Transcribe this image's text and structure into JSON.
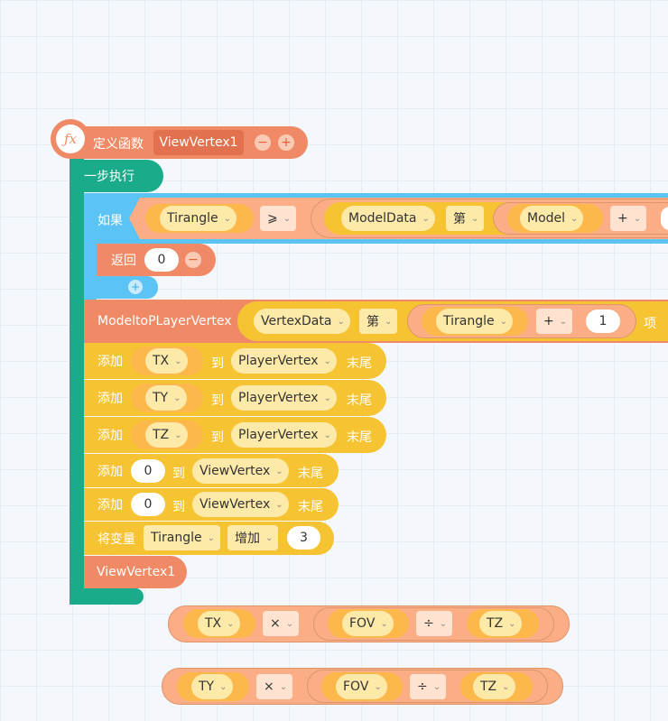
{
  "func": {
    "icon": "ƒx",
    "define_label": "定义函数",
    "name": "ViewVertex1",
    "minus": "−",
    "plus": "+"
  },
  "step_block": {
    "label": "一步执行"
  },
  "if_block": {
    "label": "如果",
    "var1": "Tirangle",
    "op": "⩾",
    "list": "ModelData",
    "nth": "第",
    "var2": "Model",
    "plus_op": "+",
    "add_button": "+"
  },
  "return_block": {
    "label": "返回",
    "value": "0",
    "minus": "−"
  },
  "call_block": {
    "name": "ModeltoPLayerVertex",
    "list": "VertexData",
    "nth": "第",
    "var": "Tirangle",
    "op": "+",
    "num": "1",
    "item": "项"
  },
  "add_rows": [
    {
      "add": "添加",
      "var": "TX",
      "to": "到",
      "list": "PlayerVertex",
      "end": "末尾"
    },
    {
      "add": "添加",
      "var": "TY",
      "to": "到",
      "list": "PlayerVertex",
      "end": "末尾"
    },
    {
      "add": "添加",
      "var": "TZ",
      "to": "到",
      "list": "PlayerVertex",
      "end": "末尾"
    },
    {
      "add": "添加",
      "var": "0",
      "to": "到",
      "list": "ViewVertex",
      "end": "末尾"
    },
    {
      "add": "添加",
      "var": "0",
      "to": "到",
      "list": "ViewVertex",
      "end": "末尾"
    }
  ],
  "var_change": {
    "label": "将变量",
    "var": "Tirangle",
    "op": "增加",
    "value": "3"
  },
  "self_call": {
    "name": "ViewVertex1"
  },
  "expr1": {
    "a": "TX",
    "op1": "×",
    "b": "FOV",
    "op2": "÷",
    "c": "TZ"
  },
  "expr2": {
    "a": "TY",
    "op1": "×",
    "b": "FOV",
    "op2": "÷",
    "c": "TZ"
  },
  "chevron": "⌄",
  "colors": {
    "define": "#f08a66",
    "step": "#1aab8a",
    "control": "#5cc3f5",
    "list_op": "#f6c433",
    "operator": "#fbae85",
    "variable": "#fcb84a"
  }
}
